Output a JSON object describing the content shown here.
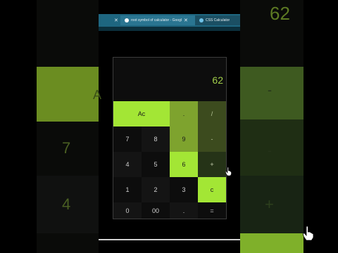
{
  "browser": {
    "tabs": [
      {
        "title": "",
        "close": "✕"
      },
      {
        "title": "root symbol of calculator - Googl",
        "close": "✕"
      },
      {
        "title": "CSS Calculator",
        "close": ""
      }
    ]
  },
  "calculator": {
    "display": "62",
    "rows": [
      [
        {
          "label": "Ac"
        },
        {
          "label": "."
        },
        {
          "label": "/"
        }
      ],
      [
        {
          "label": "7"
        },
        {
          "label": "8"
        },
        {
          "label": "9"
        },
        {
          "label": "-"
        }
      ],
      [
        {
          "label": "4"
        },
        {
          "label": "5"
        },
        {
          "label": "6"
        },
        {
          "label": "+"
        }
      ],
      [
        {
          "label": "1"
        },
        {
          "label": "2"
        },
        {
          "label": "3"
        },
        {
          "label": "c"
        }
      ],
      [
        {
          "label": "0"
        },
        {
          "label": "00"
        },
        {
          "label": "."
        },
        {
          "label": "="
        }
      ]
    ]
  },
  "background": {
    "big_display": "62",
    "left_seven": "7",
    "left_four": "4",
    "left_ac": "A",
    "right_plus": "+",
    "right_dash_top": "-",
    "right_dash_mid": "-"
  },
  "colors": {
    "accent_lime": "#a3e635",
    "display_text": "#a2cf4a",
    "tab_bar": "#1e6680"
  }
}
